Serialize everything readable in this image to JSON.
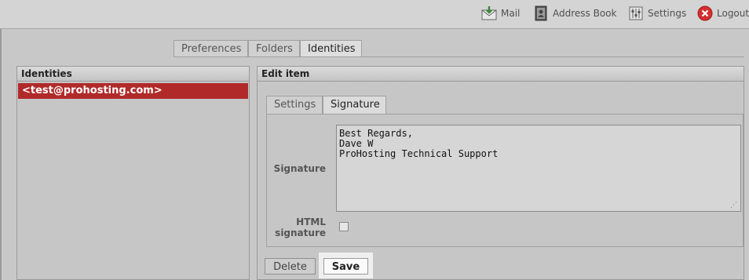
{
  "topnav": {
    "mail": "Mail",
    "address_book": "Address Book",
    "settings": "Settings",
    "logout": "Logout"
  },
  "tabs": [
    {
      "label": "Preferences",
      "active": false
    },
    {
      "label": "Folders",
      "active": false
    },
    {
      "label": "Identities",
      "active": true
    }
  ],
  "identities_panel": {
    "title": "Identities",
    "items": [
      "<test@prohosting.com>"
    ]
  },
  "edit_panel": {
    "title": "Edit item",
    "subtabs": [
      {
        "label": "Settings",
        "active": false
      },
      {
        "label": "Signature",
        "active": true
      }
    ],
    "signature_label": "Signature",
    "signature_text": "Best Regards,\nDave W\nProHosting Technical Support",
    "html_signature_label_1": "HTML",
    "html_signature_label_2": "signature",
    "html_signature_checked": false,
    "delete_label": "Delete",
    "save_label": "Save"
  },
  "colors": {
    "selected_row": "#b12a2a",
    "logout_icon": "#d23030",
    "mail_icon": "#3a8a3a"
  }
}
